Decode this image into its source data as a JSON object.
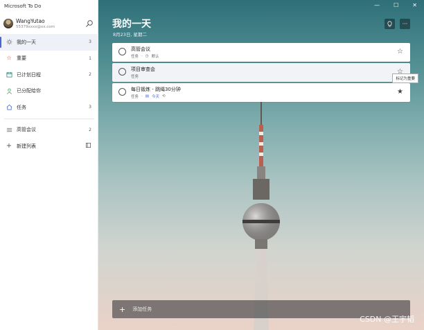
{
  "app": {
    "title": "Microsoft To Do"
  },
  "profile": {
    "name": "WangYutao",
    "email": "55379xxxx@xx.com"
  },
  "sidebar": {
    "items": [
      {
        "label": "我的一天",
        "count": "3",
        "icon": "sun-icon"
      },
      {
        "label": "重要",
        "count": "1",
        "icon": "star-icon"
      },
      {
        "label": "已计划日程",
        "count": "2",
        "icon": "calendar-icon"
      },
      {
        "label": "已分配给你",
        "count": "",
        "icon": "person-icon"
      },
      {
        "label": "任务",
        "count": "3",
        "icon": "home-icon"
      }
    ],
    "lists": [
      {
        "label": "高管会议",
        "count": "2",
        "icon": "list-icon"
      }
    ],
    "new_list_label": "新建列表"
  },
  "main": {
    "title": "我的一天",
    "date": "8月23日, 星期二",
    "window_controls": [
      "—",
      "☐",
      "✕"
    ]
  },
  "tasks": [
    {
      "title": "高管会议",
      "list": "任务",
      "extra": "默认",
      "starred": false
    },
    {
      "title": "项目审查会",
      "list": "任务",
      "extra": "",
      "starred": false,
      "tooltip": "标记为重要"
    },
    {
      "title": "每日锻炼 - 跳绳30分钟",
      "list": "任务",
      "extra": "今天",
      "starred": true
    }
  ],
  "add_task": {
    "label": "添加任务"
  },
  "watermark": "CSDN @王宇韬"
}
